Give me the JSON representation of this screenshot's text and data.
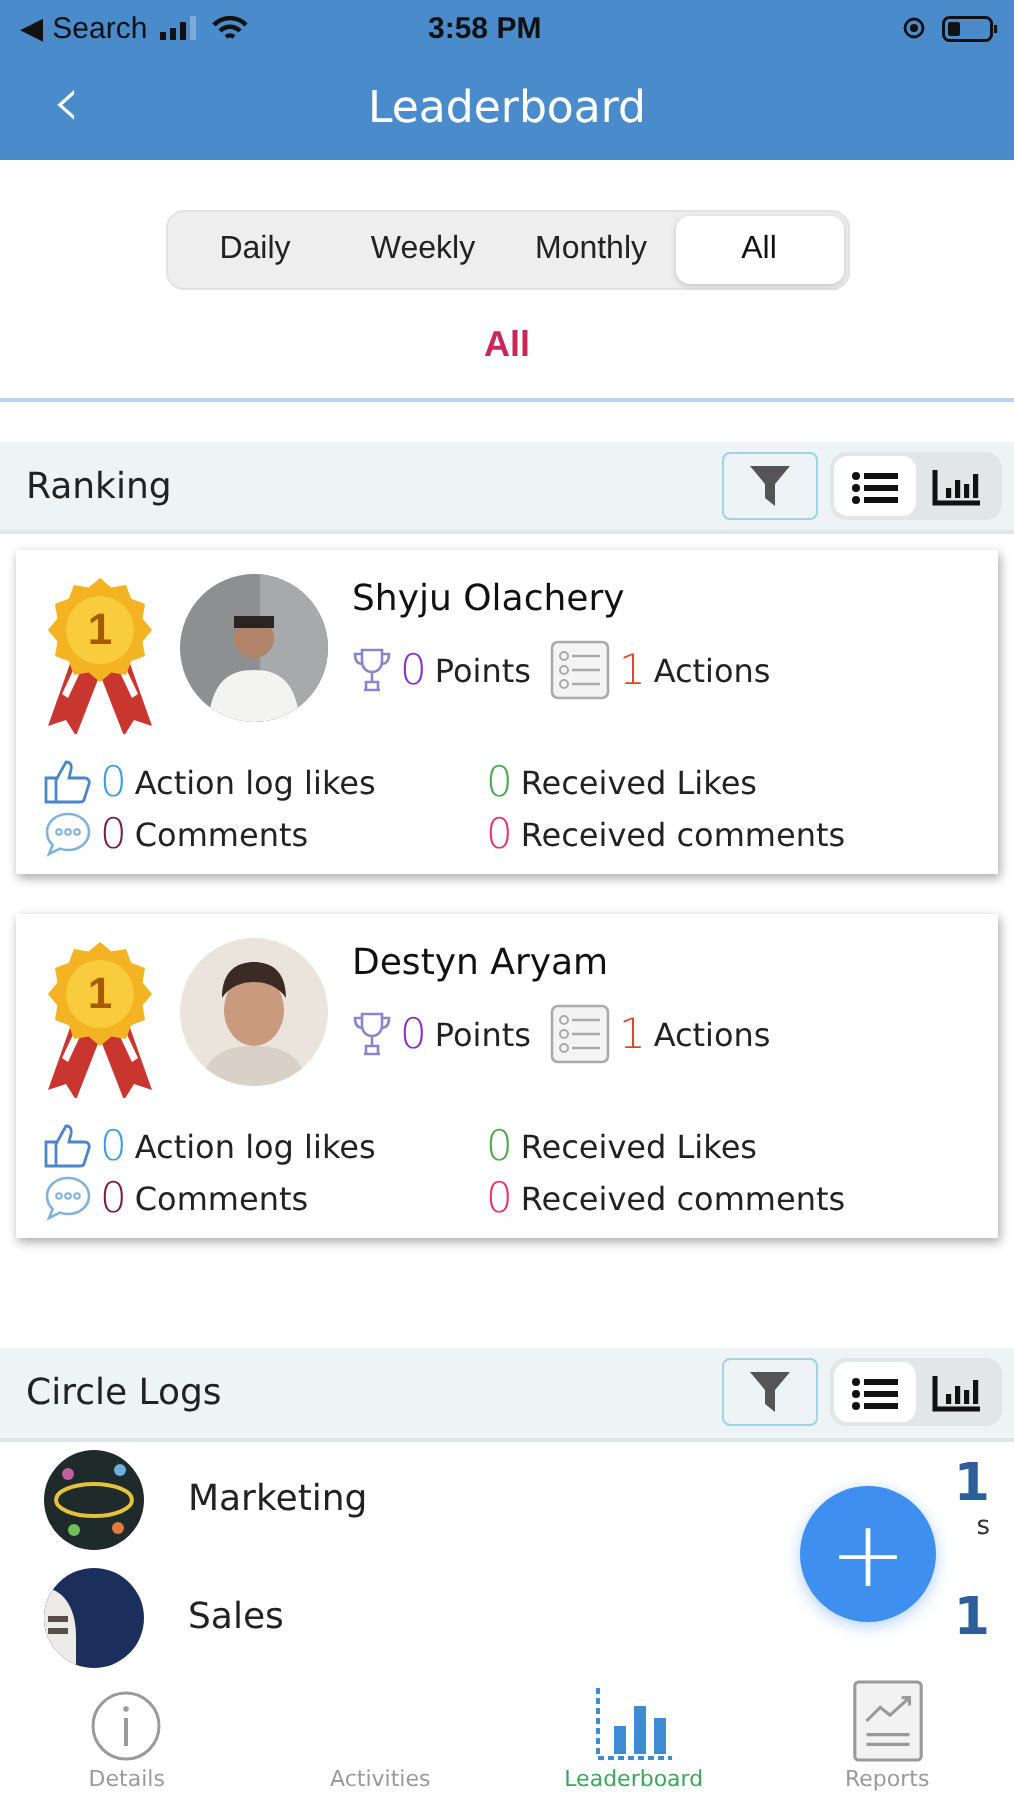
{
  "status_bar": {
    "back_label": "◀ Search",
    "time": "3:58 PM"
  },
  "header": {
    "back": "‹",
    "title": "Leaderboard"
  },
  "period_tabs": [
    {
      "label": "Daily",
      "selected": false
    },
    {
      "label": "Weekly",
      "selected": false
    },
    {
      "label": "Monthly",
      "selected": false
    },
    {
      "label": "All",
      "selected": true
    }
  ],
  "period_caption": "All",
  "ranking": {
    "title": "Ranking",
    "views": [
      {
        "kind": "list",
        "selected": true
      },
      {
        "kind": "chart",
        "selected": false
      }
    ],
    "entries": [
      {
        "rank": "1",
        "name": "Shyju Olachery",
        "points": "0",
        "points_label": "Points",
        "actions": "1",
        "actions_label": "Actions",
        "action_log_likes": "0",
        "action_log_likes_label": "Action log likes",
        "received_likes": "0",
        "received_likes_label": "Received Likes",
        "comments": "0",
        "comments_label": "Comments",
        "received_comments": "0",
        "received_comments_label": "Received comments"
      },
      {
        "rank": "1",
        "name": "Destyn Aryam",
        "points": "0",
        "points_label": "Points",
        "actions": "1",
        "actions_label": "Actions",
        "action_log_likes": "0",
        "action_log_likes_label": "Action log likes",
        "received_likes": "0",
        "received_likes_label": "Received Likes",
        "comments": "0",
        "comments_label": "Comments",
        "received_comments": "0",
        "received_comments_label": "Received comments"
      }
    ]
  },
  "circle_logs": {
    "title": "Circle Logs",
    "views": [
      {
        "kind": "list",
        "selected": true
      },
      {
        "kind": "chart",
        "selected": false
      }
    ],
    "rows": [
      {
        "name": "Marketing",
        "count": "1",
        "count_label": "s"
      },
      {
        "name": "Sales",
        "count": "1"
      }
    ]
  },
  "fab": {
    "label": "+"
  },
  "tab_bar": [
    {
      "kind": "info",
      "label": "Details",
      "selected": false
    },
    {
      "kind": "none",
      "label": "Activities",
      "selected": false
    },
    {
      "kind": "chart",
      "label": "Leaderboard",
      "selected": true
    },
    {
      "kind": "report",
      "label": "Reports",
      "selected": false
    }
  ]
}
